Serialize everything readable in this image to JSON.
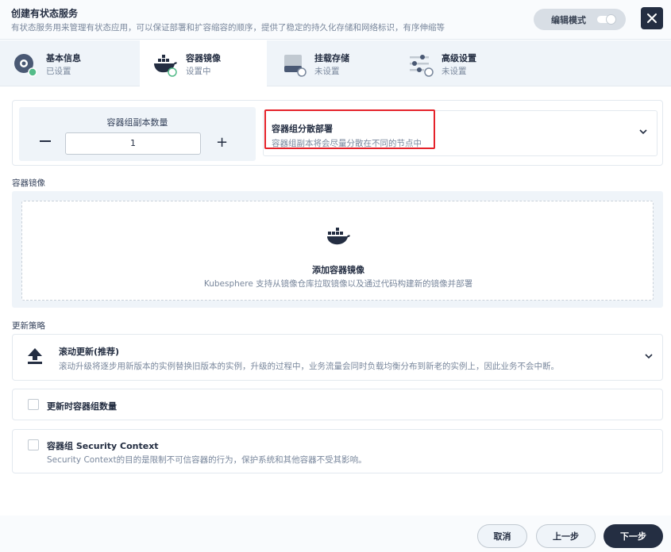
{
  "header": {
    "title": "创建有状态服务",
    "description": "有状态服务用来管理有状态应用，可以保证部署和扩容缩容的顺序，提供了稳定的持久化存储和网络标识，有序伸缩等",
    "edit_mode_label": "编辑模式",
    "close_icon": "close-icon"
  },
  "tabs": [
    {
      "label": "基本信息",
      "status": "已设置",
      "icon": "cube-icon",
      "state": "done"
    },
    {
      "label": "容器镜像",
      "status": "设置中",
      "icon": "docker-icon",
      "state": "active"
    },
    {
      "label": "挂载存储",
      "status": "未设置",
      "icon": "disk-icon",
      "state": "pending"
    },
    {
      "label": "高级设置",
      "status": "未设置",
      "icon": "sliders-icon",
      "state": "pending"
    }
  ],
  "replicas": {
    "label": "容器组副本数量",
    "value": "1",
    "minus": "−",
    "plus": "+"
  },
  "spread": {
    "title": "容器组分散部署",
    "description": "容器组副本将会尽量分散在不同的节点中"
  },
  "image_section": {
    "label": "容器镜像",
    "add_title": "添加容器镜像",
    "add_description": "Kubesphere 支持从镜像仓库拉取镜像以及通过代码构建新的镜像并部署"
  },
  "update_strategy": {
    "label": "更新策略",
    "title": "滚动更新(推荐)",
    "description": "滚动升级将逐步用新版本的实例替换旧版本的实例，升级的过程中，业务流量会同时负载均衡分布到新老的实例上，因此业务不会中断。"
  },
  "update_pod_count": {
    "title": "更新时容器组数量"
  },
  "security_context": {
    "title": "容器组 Security Context",
    "description": "Security Context的目的是限制不可信容器的行为，保护系统和其他容器不受其影响。"
  },
  "footer": {
    "cancel": "取消",
    "prev": "上一步",
    "next": "下一步"
  },
  "colors": {
    "accent_green": "#55bc8a",
    "dark": "#242e42",
    "highlight_red": "#e5222a"
  }
}
